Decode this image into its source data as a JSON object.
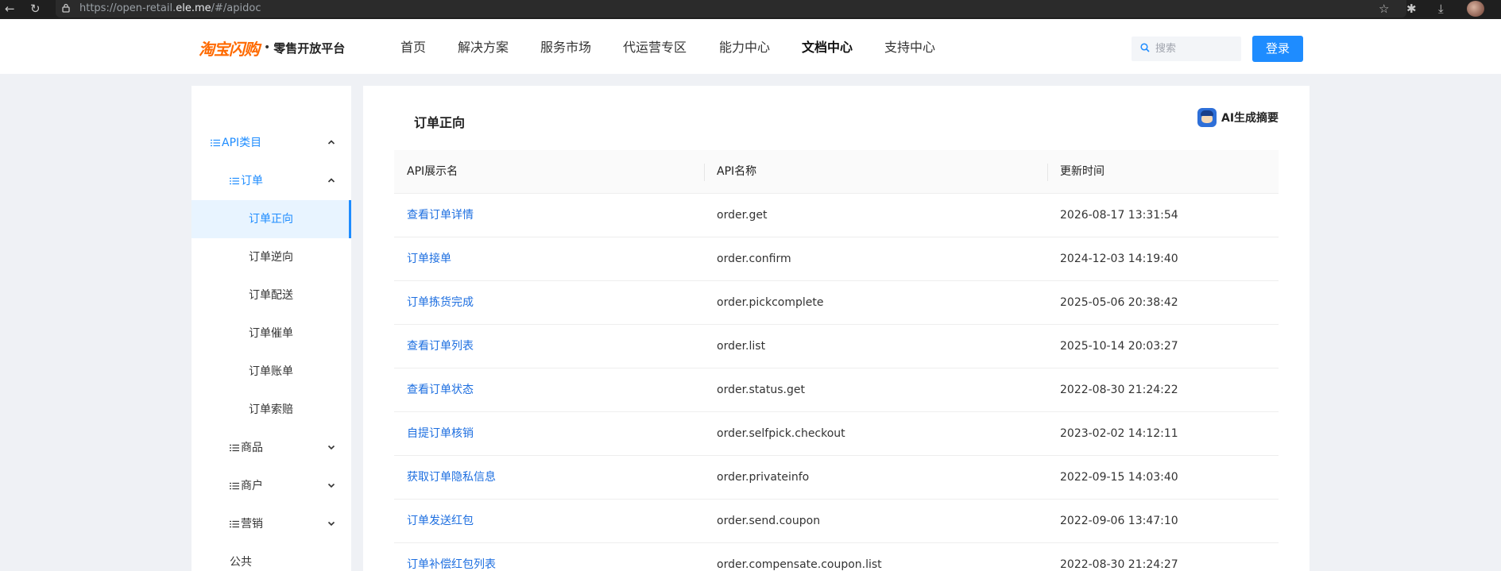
{
  "browser": {
    "url_prefix": "https://open-retail.",
    "url_domain": "ele.me",
    "url_path": "/#/apidoc"
  },
  "header": {
    "logo_brand": "淘宝闪购",
    "logo_dot": "•",
    "logo_sub": "零售开放平台",
    "nav": [
      "首页",
      "解决方案",
      "服务市场",
      "代运营专区",
      "能力中心",
      "文档中心",
      "支持中心"
    ],
    "active_nav": "文档中心",
    "search_placeholder": "搜索",
    "login_label": "登录"
  },
  "sidebar": {
    "root": "API类目",
    "group": "订单",
    "items": [
      "订单正向",
      "订单逆向",
      "订单配送",
      "订单催单",
      "订单账单",
      "订单索赔"
    ],
    "selected": "订单正向",
    "collapsed": [
      "商品",
      "商户",
      "营销"
    ],
    "plain": "公共"
  },
  "main": {
    "title": "订单正向",
    "ai_label": "AI生成摘要",
    "columns": [
      "API展示名",
      "API名称",
      "更新时间"
    ],
    "rows": [
      {
        "display": "查看订单详情",
        "name": "order.get",
        "time": "2026-08-17 13:31:54"
      },
      {
        "display": "订单接单",
        "name": "order.confirm",
        "time": "2024-12-03 14:19:40"
      },
      {
        "display": "订单拣货完成",
        "name": "order.pickcomplete",
        "time": "2025-05-06 20:38:42"
      },
      {
        "display": "查看订单列表",
        "name": "order.list",
        "time": "2025-10-14 20:03:27"
      },
      {
        "display": "查看订单状态",
        "name": "order.status.get",
        "time": "2022-08-30 21:24:22"
      },
      {
        "display": "自提订单核销",
        "name": "order.selfpick.checkout",
        "time": "2023-02-02 14:12:11"
      },
      {
        "display": "获取订单隐私信息",
        "name": "order.privateinfo",
        "time": "2022-09-15 14:03:40"
      },
      {
        "display": "订单发送红包",
        "name": "order.send.coupon",
        "time": "2022-09-06 13:47:10"
      },
      {
        "display": "订单补偿红包列表",
        "name": "order.compensate.coupon.list",
        "time": "2022-08-30 21:24:27"
      }
    ]
  },
  "colors": {
    "accent": "#1e8cff",
    "link": "#1e6fe0",
    "brand_orange": "#ff6a00"
  }
}
